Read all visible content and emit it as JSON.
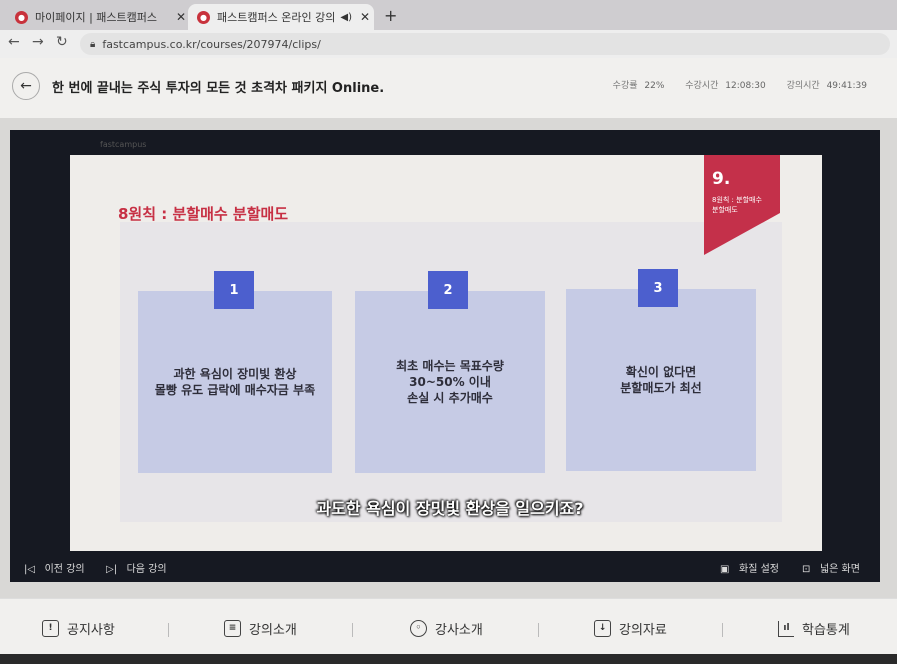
{
  "browser": {
    "tabs": [
      {
        "title": "마이페이지 | 패스트캠퍼스",
        "active": false
      },
      {
        "title": "패스트캠퍼스 온라인 강의",
        "active": true
      }
    ],
    "url": "fastcampus.co.kr/courses/207974/clips/"
  },
  "course": {
    "title": "한 번에 끝내는 주식 투자의 모든 것 초격차 패키지 Online.",
    "stats": [
      {
        "label": "수강률",
        "value": "22%"
      },
      {
        "label": "수강시간",
        "value": "12:08:30"
      },
      {
        "label": "강의시간",
        "value": "49:41:39"
      }
    ]
  },
  "slide": {
    "title": "8원칙 : 분할매수 분할매도",
    "badge_number": "9.",
    "badge_label": "8원칙 : 분할매수\n분할매도",
    "cards": [
      {
        "num": "1",
        "text": "과한 욕심이 장미빛 환상\n몰빵 유도 급락에 매수자금 부족"
      },
      {
        "num": "2",
        "text": "최초 매수는 목표수량\n30~50% 이내\n손실 시 추가매수"
      },
      {
        "num": "3",
        "text": "확신이 없다면\n분할매도가 최선"
      }
    ],
    "subtitle": "과도한 욕심이 장밋빛 환상을 일으키죠?"
  },
  "player": {
    "prev_label": "이전 강의",
    "next_label": "다음 강의",
    "quality_label": "화질 설정",
    "wide_label": "넓은 화면"
  },
  "bottom_nav": [
    "공지사항",
    "강의소개",
    "강사소개",
    "강의자료",
    "학습통계"
  ],
  "colors": {
    "accent_red": "#c4304a",
    "card_blue": "#c6cbe5",
    "badge_blue": "#4c5fce"
  }
}
